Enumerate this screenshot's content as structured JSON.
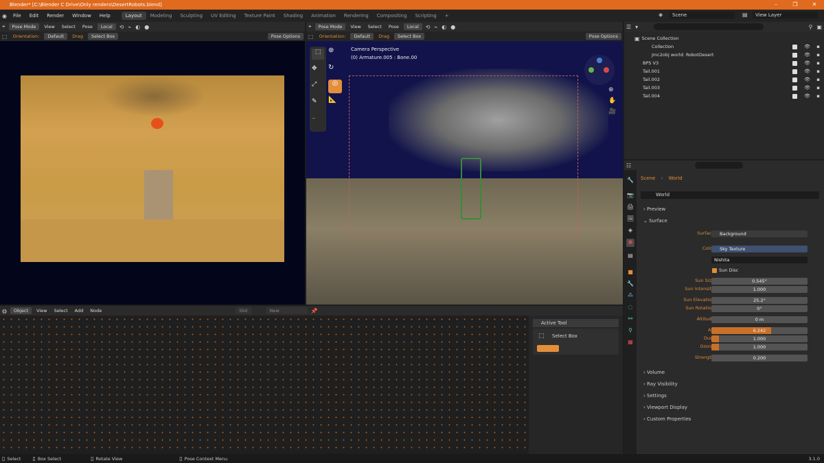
{
  "window": {
    "title": "Blender* [C:\\Blender C Drive\\Only renders\\DesertRobots.blend]"
  },
  "menu": [
    "File",
    "Edit",
    "Render",
    "Window",
    "Help"
  ],
  "workspaces": [
    "Layout",
    "Modeling",
    "Sculpting",
    "UV Editing",
    "Texture Paint",
    "Shading",
    "Animation",
    "Rendering",
    "Compositing",
    "Scripting"
  ],
  "active_workspace": "Layout",
  "scene_field": "Scene",
  "view_layer_field": "View Layer",
  "left_view": {
    "mode": "Pose Mode",
    "menus": [
      "View",
      "Select",
      "Pose"
    ],
    "transform": "Local",
    "orientation_label": "Orientation:",
    "orientation_value": "Default",
    "drag_label": "Drag",
    "drag_value": "Select Box",
    "pose_options": "Pose Options"
  },
  "mid_view": {
    "mode": "Pose Mode",
    "menus": [
      "View",
      "Select",
      "Pose"
    ],
    "transform": "Local",
    "orientation_label": "Orientation:",
    "orientation_value": "Default",
    "drag_label": "Drag",
    "drag_value": "Select Box",
    "pose_options": "Pose Options",
    "overlay_title": "Camera Perspective",
    "overlay_sub": "(0) Armature.005 : Bone.00"
  },
  "outliner": {
    "root": "Scene Collection",
    "items": [
      {
        "name": "Collection"
      },
      {
        "name": "jmc2obj world: RobotDesert"
      },
      {
        "name": "BPS V3"
      },
      {
        "name": "Tail.001"
      },
      {
        "name": "Tail.002"
      },
      {
        "name": "Tail.003"
      },
      {
        "name": "Tail.004"
      }
    ]
  },
  "properties": {
    "breadcrumb": [
      "Scene",
      "World"
    ],
    "datablock": "World",
    "sections": {
      "preview": "Preview",
      "surface": "Surface"
    },
    "surface_label": "Surface",
    "surface_value": "Background",
    "color_label": "Color",
    "color_value": "Sky Texture",
    "sky_type": "Nishita",
    "sun_disc": "Sun Disc",
    "fields": [
      {
        "label": "Sun Size",
        "value": "0.545°"
      },
      {
        "label": "Sun Intensity",
        "value": "1.000"
      },
      {
        "label": "Sun Elevation",
        "value": "25.2°"
      },
      {
        "label": "Sun Rotation",
        "value": "0°"
      },
      {
        "label": "Altitude",
        "value": "0 m"
      },
      {
        "label": "Air",
        "value": "6.242"
      },
      {
        "label": "Dust",
        "value": "1.000"
      },
      {
        "label": "Ozone",
        "value": "1.000"
      },
      {
        "label": "Strength",
        "value": "0.200"
      }
    ],
    "collapsed": [
      "Volume",
      "Ray Visibility",
      "Settings",
      "Viewport Display",
      "Custom Properties"
    ]
  },
  "node_editor": {
    "type": "Object",
    "menus": [
      "View",
      "Select",
      "Add",
      "Node"
    ],
    "slot": "Slot",
    "new_button": "New"
  },
  "tool_panel": {
    "title": "Active Tool",
    "tool": "Select Box"
  },
  "status": {
    "select": "Select",
    "box_select": "Box Select",
    "rotate": "Rotate View",
    "context": "Pose Context Menu",
    "version": "3.1.0"
  },
  "colors": {
    "accent": "#e06a1e",
    "selected": "#e28e3a",
    "field": "#545454"
  }
}
